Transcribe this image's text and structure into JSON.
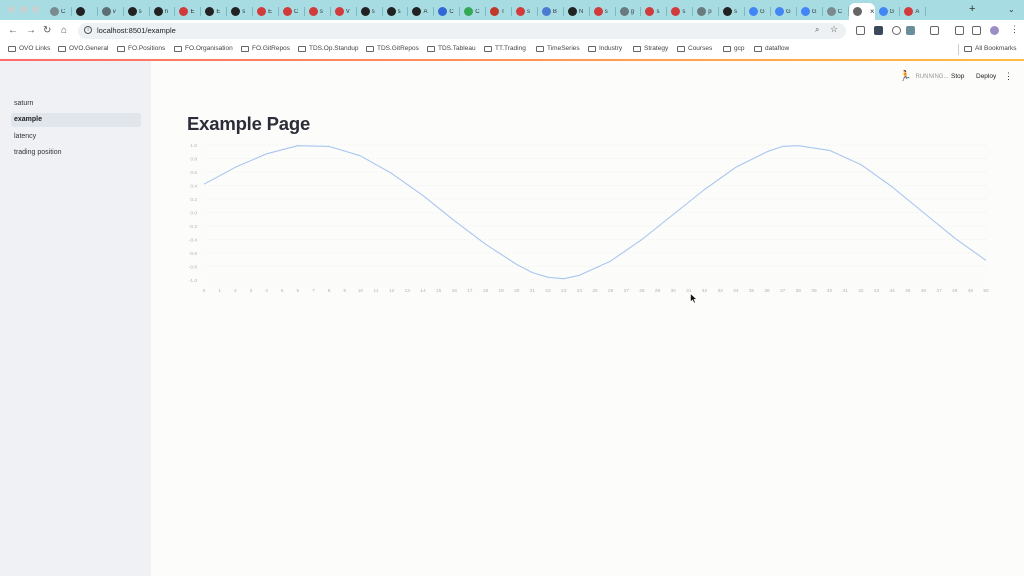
{
  "browser": {
    "tabs": [
      {
        "icon": "chrome-icon",
        "title": "C",
        "color": "#7a8a8e"
      },
      {
        "icon": "github-icon",
        "title": "",
        "color": "#222"
      },
      {
        "icon": "globe-icon",
        "title": "v",
        "color": "#5a6e73"
      },
      {
        "icon": "streamlit-icon",
        "title": "s",
        "color": "#222"
      },
      {
        "icon": "github-icon",
        "title": "n",
        "color": "#222"
      },
      {
        "icon": "crown-icon",
        "title": "E",
        "color": "#d23b3b"
      },
      {
        "icon": "github-icon",
        "title": "E",
        "color": "#222"
      },
      {
        "icon": "streamlit-icon",
        "title": "s",
        "color": "#222"
      },
      {
        "icon": "crown-icon",
        "title": "E",
        "color": "#d23b3b"
      },
      {
        "icon": "crown-icon",
        "title": "C",
        "color": "#d23b3b"
      },
      {
        "icon": "crown-icon",
        "title": "s",
        "color": "#d23b3b"
      },
      {
        "icon": "crown-icon",
        "title": "V",
        "color": "#d23b3b"
      },
      {
        "icon": "streamlit-icon",
        "title": "s",
        "color": "#222"
      },
      {
        "icon": "streamlit-icon",
        "title": "s",
        "color": "#222"
      },
      {
        "icon": "github-icon",
        "title": "A",
        "color": "#222"
      },
      {
        "icon": "app-icon",
        "title": "C",
        "color": "#3367d6"
      },
      {
        "icon": "app-icon",
        "title": "C",
        "color": "#34a853"
      },
      {
        "icon": "app-icon",
        "title": "T",
        "color": "#c0392b"
      },
      {
        "icon": "crown-icon",
        "title": "s",
        "color": "#d23b3b"
      },
      {
        "icon": "search-icon",
        "title": "B",
        "color": "#4a7bd0"
      },
      {
        "icon": "github-icon",
        "title": "N",
        "color": "#222"
      },
      {
        "icon": "crown-icon",
        "title": "s",
        "color": "#d23b3b"
      },
      {
        "icon": "chart-icon",
        "title": "g",
        "color": "#6a7b7f"
      },
      {
        "icon": "crown-icon",
        "title": "s",
        "color": "#d23b3b"
      },
      {
        "icon": "crown-icon",
        "title": "s",
        "color": "#d23b3b"
      },
      {
        "icon": "chart-icon",
        "title": "p",
        "color": "#6a7b7f"
      },
      {
        "icon": "streamlit-icon",
        "title": "s",
        "color": "#222"
      },
      {
        "icon": "google-icon",
        "title": "G",
        "color": "#4285f4"
      },
      {
        "icon": "google-icon",
        "title": "G",
        "color": "#4285f4"
      },
      {
        "icon": "google-icon",
        "title": "G",
        "color": "#4285f4"
      },
      {
        "icon": "chrome-icon",
        "title": "C",
        "color": "#7a8a8e"
      },
      {
        "icon": "doc-icon",
        "title": "T",
        "color": "#666",
        "active": true
      },
      {
        "icon": "google-icon",
        "title": "G",
        "color": "#4285f4"
      },
      {
        "icon": "crown-icon",
        "title": "A",
        "color": "#d23b3b"
      }
    ],
    "url": "localhost:8501/example",
    "bookmarks": [
      {
        "label": "OVO Links",
        "type": "folder"
      },
      {
        "label": "OVO.General",
        "type": "folder"
      },
      {
        "label": "FO.Positions",
        "type": "folder"
      },
      {
        "label": "FO.Organisation",
        "type": "folder"
      },
      {
        "label": "FO.GitRepos",
        "type": "folder"
      },
      {
        "label": "TDS.Op.Standup",
        "type": "folder"
      },
      {
        "label": "TDS.GitRepos",
        "type": "folder"
      },
      {
        "label": "TDS.Tableau",
        "type": "folder"
      },
      {
        "label": "TT.Trading",
        "type": "folder"
      },
      {
        "label": "TimeSeries",
        "type": "folder"
      },
      {
        "label": "Industry",
        "type": "folder"
      },
      {
        "label": "Strategy",
        "type": "folder"
      },
      {
        "label": "Courses",
        "type": "folder"
      },
      {
        "label": "gcp",
        "type": "folder"
      },
      {
        "label": "dataflow",
        "type": "folder"
      }
    ],
    "all_bookmarks": "All Bookmarks"
  },
  "app": {
    "sidebar": {
      "items": [
        {
          "label": "saturn",
          "active": false
        },
        {
          "label": "example",
          "active": true
        },
        {
          "label": "latency",
          "active": false
        },
        {
          "label": "trading position",
          "active": false
        }
      ]
    },
    "header": {
      "status": "RUNNING...",
      "stop": "Stop",
      "deploy": "Deploy"
    },
    "page_title": "Example Page"
  },
  "chart_data": {
    "type": "line",
    "title": "",
    "xlabel": "",
    "ylabel": "",
    "xlim": [
      0,
      50
    ],
    "ylim": [
      -1.0,
      1.0
    ],
    "x_ticks": [
      0,
      1,
      2,
      3,
      4,
      5,
      6,
      7,
      8,
      9,
      10,
      11,
      12,
      13,
      14,
      15,
      16,
      17,
      18,
      19,
      20,
      21,
      22,
      23,
      24,
      25,
      26,
      27,
      28,
      29,
      30,
      31,
      32,
      33,
      34,
      35,
      36,
      37,
      38,
      39,
      40,
      41,
      42,
      43,
      44,
      45,
      46,
      47,
      48,
      49,
      50
    ],
    "y_ticks": [
      1.0,
      0.8,
      0.6,
      0.4,
      0.2,
      0.0,
      -0.2,
      -0.4,
      -0.6,
      -0.8,
      -1.0
    ],
    "y_tick_labels": [
      "1.0",
      "0.8",
      "0.6",
      "0.4",
      "0.2",
      "0.0",
      "-0.2",
      "-0.4",
      "-0.6",
      "-0.8",
      "-1.0"
    ],
    "grid": true,
    "line_color": "#a9c6ee",
    "series": [
      {
        "values": [
          {
            "x": 0,
            "y": 0.42
          },
          {
            "x": 2,
            "y": 0.67
          },
          {
            "x": 4,
            "y": 0.87
          },
          {
            "x": 6,
            "y": 0.99
          },
          {
            "x": 8,
            "y": 0.98
          },
          {
            "x": 10,
            "y": 0.84
          },
          {
            "x": 12,
            "y": 0.58
          },
          {
            "x": 14,
            "y": 0.25
          },
          {
            "x": 16,
            "y": -0.12
          },
          {
            "x": 18,
            "y": -0.47
          },
          {
            "x": 20,
            "y": -0.77
          },
          {
            "x": 21,
            "y": -0.89
          },
          {
            "x": 22,
            "y": -0.96
          },
          {
            "x": 23,
            "y": -0.98
          },
          {
            "x": 24,
            "y": -0.93
          },
          {
            "x": 26,
            "y": -0.72
          },
          {
            "x": 28,
            "y": -0.4
          },
          {
            "x": 30,
            "y": -0.03
          },
          {
            "x": 32,
            "y": 0.34
          },
          {
            "x": 34,
            "y": 0.67
          },
          {
            "x": 36,
            "y": 0.9
          },
          {
            "x": 37,
            "y": 0.98
          },
          {
            "x": 38,
            "y": 0.99
          },
          {
            "x": 40,
            "y": 0.92
          },
          {
            "x": 42,
            "y": 0.71
          },
          {
            "x": 44,
            "y": 0.38
          },
          {
            "x": 46,
            "y": 0.0
          },
          {
            "x": 48,
            "y": -0.38
          },
          {
            "x": 50,
            "y": -0.71
          }
        ]
      }
    ]
  }
}
